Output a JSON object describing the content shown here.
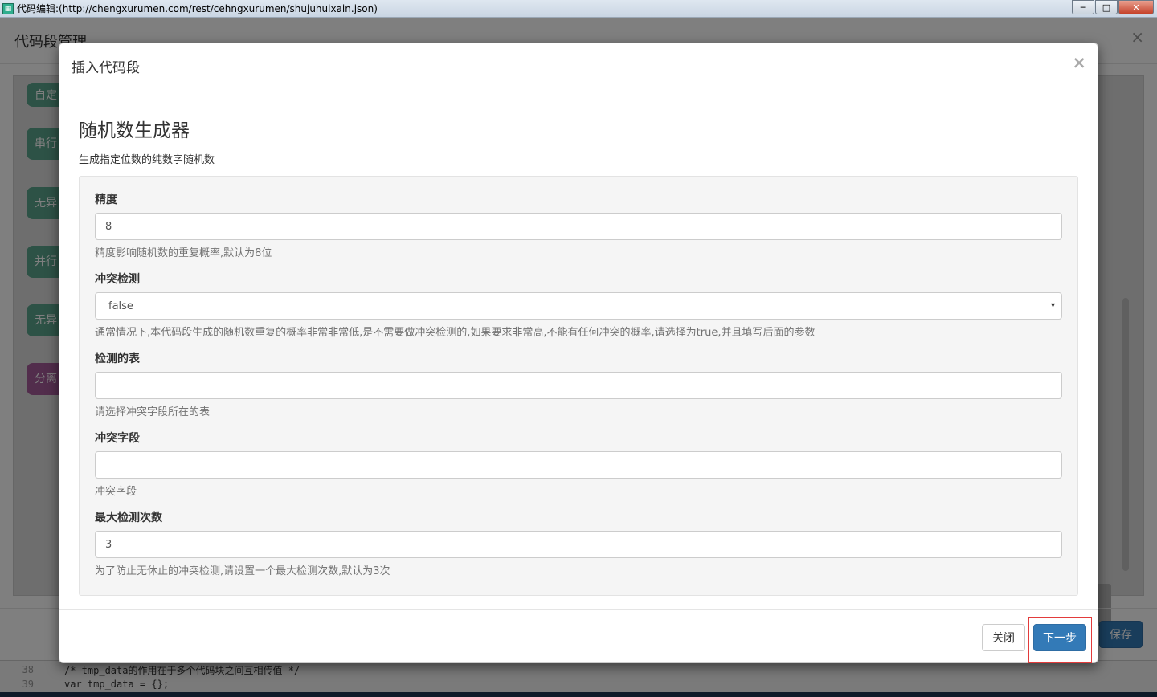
{
  "window": {
    "title": "代码编辑:(http://chengxurumen.com/rest/cehngxurumen/shujuhuixain.json)",
    "minimize_glyph": "─",
    "maximize_glyph": "□",
    "close_glyph": "✕"
  },
  "background": {
    "modal_title": "代码段管理",
    "close_glyph": "×",
    "blocks": [
      "自定",
      "串行",
      "无异",
      "并行",
      "无异",
      "分离"
    ],
    "save_label": "保存",
    "code_lines": [
      {
        "num": "38",
        "text": "/* tmp_data的作用在于多个代码块之间互相传值 */"
      },
      {
        "num": "39",
        "text": "var tmp_data = {};"
      }
    ]
  },
  "modal": {
    "title": "插入代码段",
    "close_glyph": "×",
    "heading": "随机数生成器",
    "description": "生成指定位数的纯数字随机数",
    "fields": [
      {
        "label": "精度",
        "value": "8",
        "help": "精度影响随机数的重复概率,默认为8位"
      },
      {
        "label": "冲突检测",
        "value": "false",
        "help": "通常情况下,本代码段生成的随机数重复的概率非常非常低,是不需要做冲突检测的,如果要求非常高,不能有任何冲突的概率,请选择为true,并且填写后面的参数"
      },
      {
        "label": "检测的表",
        "value": "",
        "help": "请选择冲突字段所在的表"
      },
      {
        "label": "冲突字段",
        "value": "",
        "help": "冲突字段"
      },
      {
        "label": "最大检测次数",
        "value": "3",
        "help": "为了防止无休止的冲突检测,请设置一个最大检测次数,默认为3次"
      }
    ],
    "select_caret": "▾",
    "close_button": "关闭",
    "next_button": "下一步"
  },
  "colors": {
    "primary": "#337ab7",
    "block_green": "#5ba58c",
    "block_purple": "#a55b99",
    "highlight": "#e23b3b"
  }
}
